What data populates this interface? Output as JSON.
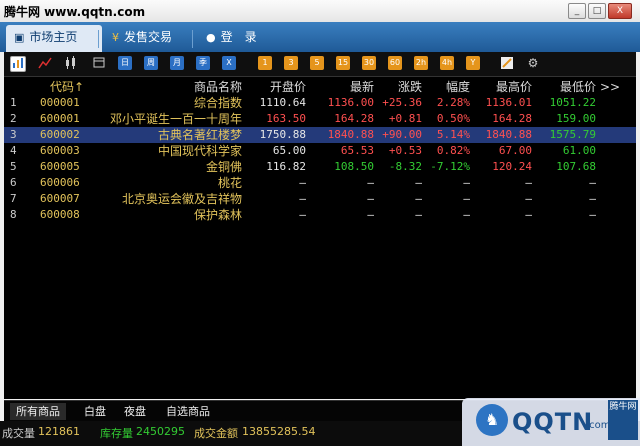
{
  "window": {
    "title": "腾牛网 www.qqtn.com",
    "btn_min": "_",
    "btn_max": "□",
    "btn_close": "X"
  },
  "tabs": [
    {
      "label": "市场主页",
      "icon": "home-icon"
    },
    {
      "label": "发售交易",
      "icon": "yen-icon"
    },
    {
      "label": "登　录",
      "icon": "user-icon"
    }
  ],
  "toolbar": {
    "day": "日",
    "week": "周",
    "month": "月",
    "quarter": "季",
    "x": "X",
    "periods": [
      "1",
      "3",
      "5",
      "15",
      "30",
      "60",
      "2h",
      "4h",
      "Y"
    ]
  },
  "columns": {
    "code": "代码↑",
    "name": "商品名称",
    "open": "开盘价",
    "last": "最新",
    "chg": "涨跌",
    "pct": "幅度",
    "high": "最高价",
    "low": "最低价",
    "more": ">>"
  },
  "rows": [
    {
      "idx": "1",
      "code": "000001",
      "name": "综合指数",
      "open": "1110.64",
      "last": "1136.00",
      "chg": "+25.36",
      "pct": "2.28%",
      "high": "1136.01",
      "low": "1051.22"
    },
    {
      "idx": "2",
      "code": "600001",
      "name": "邓小平诞生一百一十周年",
      "open": "163.50",
      "last": "164.28",
      "chg": "+0.81",
      "pct": "0.50%",
      "high": "164.28",
      "low": "159.00"
    },
    {
      "idx": "3",
      "code": "600002",
      "name": "古典名著红楼梦",
      "open": "1750.88",
      "last": "1840.88",
      "chg": "+90.00",
      "pct": "5.14%",
      "high": "1840.88",
      "low": "1575.79"
    },
    {
      "idx": "4",
      "code": "600003",
      "name": "中国现代科学家",
      "open": "65.00",
      "last": "65.53",
      "chg": "+0.53",
      "pct": "0.82%",
      "high": "67.00",
      "low": "61.00"
    },
    {
      "idx": "5",
      "code": "600005",
      "name": "金铜佛",
      "open": "116.82",
      "last": "108.50",
      "chg": "-8.32",
      "pct": "-7.12%",
      "high": "120.24",
      "low": "107.68"
    },
    {
      "idx": "6",
      "code": "600006",
      "name": "桃花",
      "open": "—",
      "last": "—",
      "chg": "—",
      "pct": "—",
      "high": "—",
      "low": "—"
    },
    {
      "idx": "7",
      "code": "600007",
      "name": "北京奥运会徽及吉祥物",
      "open": "—",
      "last": "—",
      "chg": "—",
      "pct": "—",
      "high": "—",
      "low": "—"
    },
    {
      "idx": "8",
      "code": "600008",
      "name": "保护森林",
      "open": "—",
      "last": "—",
      "chg": "—",
      "pct": "—",
      "high": "—",
      "low": "—"
    }
  ],
  "sheet_tabs": [
    "所有商品",
    "白盘",
    "夜盘",
    "自选商品"
  ],
  "status": {
    "volume_label": "成交量",
    "volume": "121861",
    "stock_label": "库存量",
    "stock": "2450295",
    "amount_label": "成交金额",
    "amount": "13855285.54"
  },
  "watermark": {
    "text": "QQTN",
    "suffix": ".com",
    "tag": "腾牛网"
  },
  "colors": {
    "up": "#ff5050",
    "down": "#33cc33",
    "accent": "#e2c35b",
    "selected_row": "#243a7a"
  }
}
